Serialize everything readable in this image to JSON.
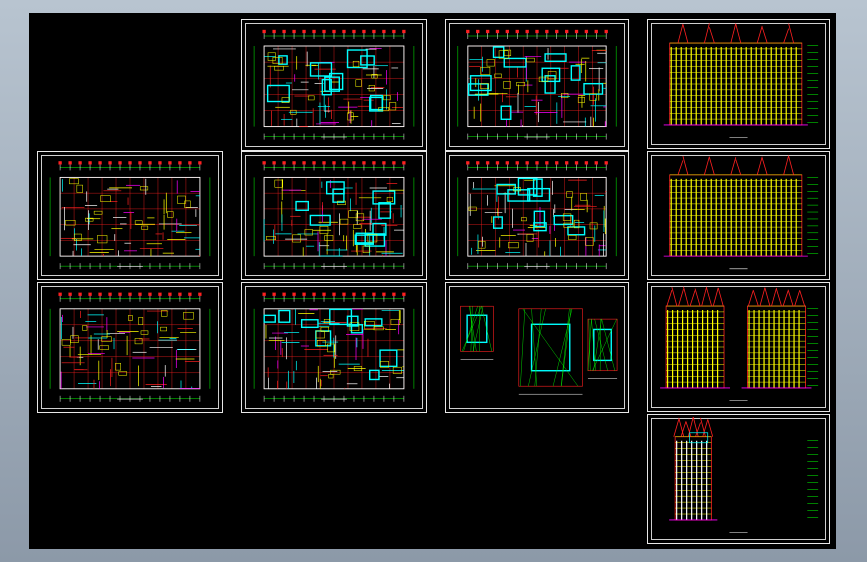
{
  "window": {
    "background": "#000000"
  },
  "sheets": [
    {
      "id": "sheet-plan-a-upper",
      "kind": "plan",
      "caption": ""
    },
    {
      "id": "sheet-plan-a-lower",
      "kind": "plan",
      "caption": ""
    },
    {
      "id": "sheet-plan-b1",
      "kind": "plan",
      "caption": ""
    },
    {
      "id": "sheet-plan-b2",
      "kind": "plan",
      "caption": ""
    },
    {
      "id": "sheet-plan-b3",
      "kind": "plan",
      "caption": ""
    },
    {
      "id": "sheet-plan-c1",
      "kind": "plan",
      "caption": ""
    },
    {
      "id": "sheet-plan-c2",
      "kind": "plan",
      "caption": ""
    },
    {
      "id": "sheet-details",
      "kind": "detail",
      "caption": ""
    },
    {
      "id": "sheet-elev-front",
      "kind": "elevation",
      "caption": ""
    },
    {
      "id": "sheet-elev-rear",
      "kind": "elevation",
      "caption": ""
    },
    {
      "id": "sheet-elev-sides",
      "kind": "elevation",
      "caption": ""
    },
    {
      "id": "sheet-section",
      "kind": "section",
      "caption": ""
    }
  ],
  "colors": {
    "red": "#ff2020",
    "yellow": "#ffff00",
    "cyan": "#00ffff",
    "green": "#00ff00",
    "white": "#ffffff",
    "magenta": "#ff00ff",
    "blue": "#4060ff"
  }
}
